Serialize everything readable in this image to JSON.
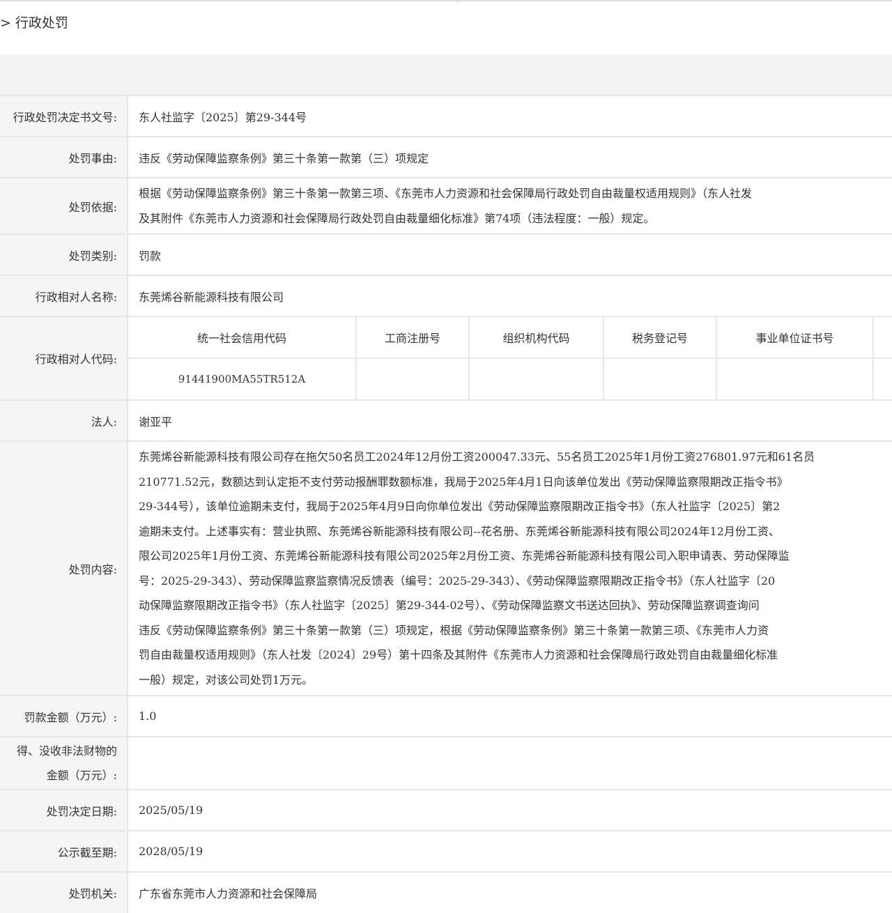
{
  "breadcrumb": {
    "separator": ">",
    "current": "行政处罚"
  },
  "rows": {
    "doc_no": {
      "label": "行政处罚决定书文号:",
      "value": "东人社监字〔2025〕第29-344号"
    },
    "reason": {
      "label": "处罚事由:",
      "value": "违反《劳动保障监察条例》第三十条第一款第（三）项规定"
    },
    "basis": {
      "label": "处罚依据:",
      "lines": [
        "根据《劳动保障监察条例》第三十条第一款第三项、《东莞市人力资源和社会保障局行政处罚自由裁量权适用规则》（东人社发",
        "及其附件《东莞市人力资源和社会保障局行政处罚自由裁量细化标准》第74项（违法程度：一般）规定。"
      ]
    },
    "category": {
      "label": "处罚类别:",
      "value": "罚款"
    },
    "party_name": {
      "label": "行政相对人名称:",
      "value": "东莞烯谷新能源科技有限公司"
    },
    "party_code": {
      "label": "行政相对人代码:",
      "headers": [
        "统一社会信用代码",
        "工商注册号",
        "组织机构代码",
        "税务登记号",
        "事业单位证书号",
        ""
      ],
      "values": [
        "91441900MA55TR512A",
        "",
        "",
        "",
        "",
        ""
      ]
    },
    "legal_rep": {
      "label": "法人:",
      "value": "谢亚平"
    },
    "content": {
      "label": "处罚内容:",
      "lines": [
        "东莞烯谷新能源科技有限公司存在拖欠50名员工2024年12月份工资200047.33元、55名员工2025年1月份工资276801.97元和61名员",
        "210771.52元，数额达到认定拒不支付劳动报酬罪数额标准，我局于2025年4月1日向该单位发出《劳动保障监察限期改正指令书》",
        "29-344号），该单位逾期未支付，我局于2025年4月9日向你单位发出《劳动保障监察限期改正指令书》（东人社监字〔2025〕第2",
        "逾期未支付。上述事实有：营业执照、东莞烯谷新能源科技有限公司--花名册、东莞烯谷新能源科技有限公司2024年12月份工资、",
        "限公司2025年1月份工资、东莞烯谷新能源科技有限公司2025年2月份工资、东莞烯谷新能源科技有限公司入职申请表、劳动保障监",
        "号：2025-29-343）、劳动保障监察监察情况反馈表（编号：2025-29-343）、《劳动保障监察限期改正指令书》（东人社监字〔20",
        "动保障监察限期改正指令书》（东人社监字〔2025〕第29-344-02号）、《劳动保障监察文书送达回执》、劳动保障监察调查询问",
        "违反《劳动保障监察条例》第三十条第一款第（三）项规定，根据《劳动保障监察条例》第三十条第一款第三项、《东莞市人力资",
        "罚自由裁量权适用规则》（东人社发〔2024〕29号）第十四条及其附件《东莞市人力资源和社会保障局行政处罚自由裁量细化标准",
        "一般）规定，对该公司处罚1万元。"
      ]
    },
    "fine": {
      "label": "罚款金额（万元）:",
      "value": "1.0"
    },
    "confiscate": {
      "label_lines": [
        "得、没收非法财物的",
        "金额（万元）:"
      ],
      "value": ""
    },
    "decision_date": {
      "label": "处罚决定日期:",
      "value": "2025/05/19"
    },
    "publish_end": {
      "label": "公示截至期:",
      "value": "2028/05/19"
    },
    "authority": {
      "label": "处罚机关:",
      "value": "广东省东莞市人力资源和社会保障局"
    }
  },
  "colors": {
    "label_bg": "#f5f5f5",
    "band_bg": "#f2f2f2",
    "border": "#e6e6e6",
    "text": "#333333"
  }
}
